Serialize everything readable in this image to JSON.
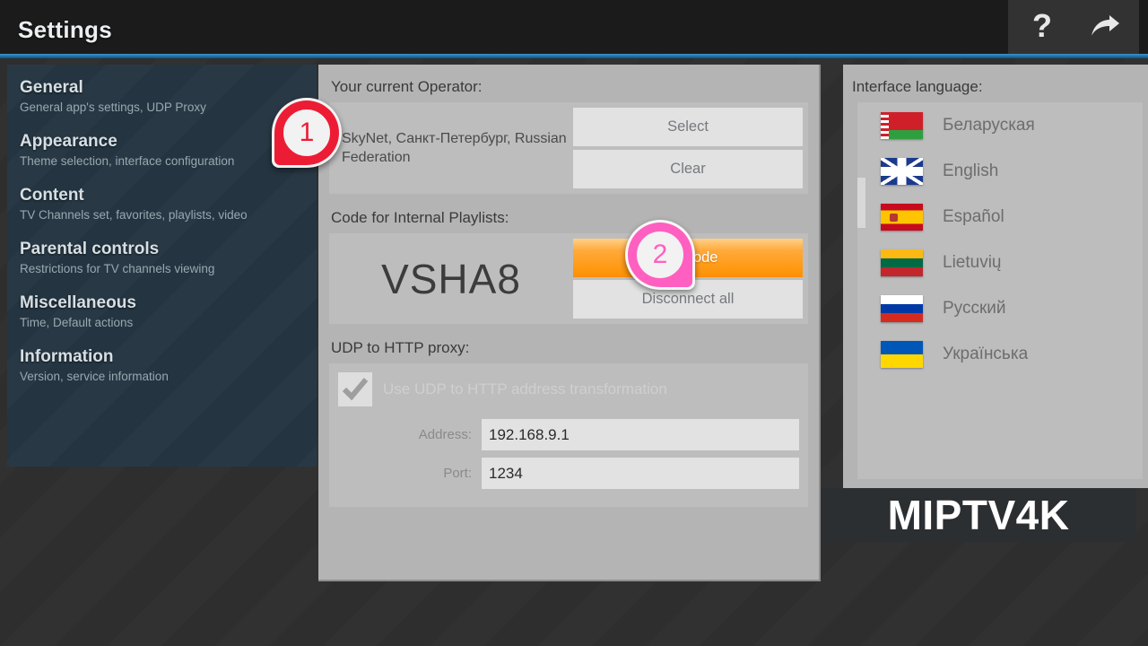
{
  "header": {
    "title": "Settings",
    "help_icon": "question-mark-icon",
    "exit_icon": "forward-arrow-icon"
  },
  "sidebar": {
    "items": [
      {
        "title": "General",
        "subtitle": "General app's settings, UDP Proxy"
      },
      {
        "title": "Appearance",
        "subtitle": "Theme selection, interface configuration"
      },
      {
        "title": "Content",
        "subtitle": "TV Channels set, favorites, playlists, video"
      },
      {
        "title": "Parental controls",
        "subtitle": "Restrictions for TV channels viewing"
      },
      {
        "title": "Miscellaneous",
        "subtitle": "Time, Default actions"
      },
      {
        "title": "Information",
        "subtitle": "Version, service information"
      }
    ]
  },
  "main": {
    "operator": {
      "label": "Your current Operator:",
      "value": "SkyNet, Санкт-Петербург, Russian Federation",
      "select_button": "Select",
      "clear_button": "Clear"
    },
    "code": {
      "label": "Code for Internal Playlists:",
      "value": "VSHA8",
      "get_code_button": "Get code",
      "disconnect_button": "Disconnect all"
    },
    "proxy": {
      "label": "UDP to HTTP proxy:",
      "checkbox_label": "Use UDP to HTTP address transformation",
      "checkbox_checked": "checked",
      "address_label": "Address:",
      "address_value": "192.168.9.1",
      "port_label": "Port:",
      "port_value": "1234"
    }
  },
  "language_panel": {
    "label": "Interface language:",
    "items": [
      {
        "name": "Беларуская",
        "flag": "flag-belarus"
      },
      {
        "name": "English",
        "flag": "flag-united-kingdom"
      },
      {
        "name": "Español",
        "flag": "flag-spain"
      },
      {
        "name": "Lietuvių",
        "flag": "flag-lithuania"
      },
      {
        "name": "Русский",
        "flag": "flag-russia"
      },
      {
        "name": "Українська",
        "flag": "flag-ukraine"
      }
    ]
  },
  "callouts": [
    {
      "number": "1",
      "color": "#ed1c35"
    },
    {
      "number": "2",
      "color": "#ff5fc0"
    }
  ],
  "watermark": {
    "text": "MIPTV4K"
  },
  "colors": {
    "accent_line": "#2d82bd",
    "header_bg": "#1b1b1b",
    "sidebar_bg": "#243541",
    "panel_bg": "#b4b4b4",
    "button_bg": "#e2e2e2",
    "primary_button": "#ff9a13"
  }
}
